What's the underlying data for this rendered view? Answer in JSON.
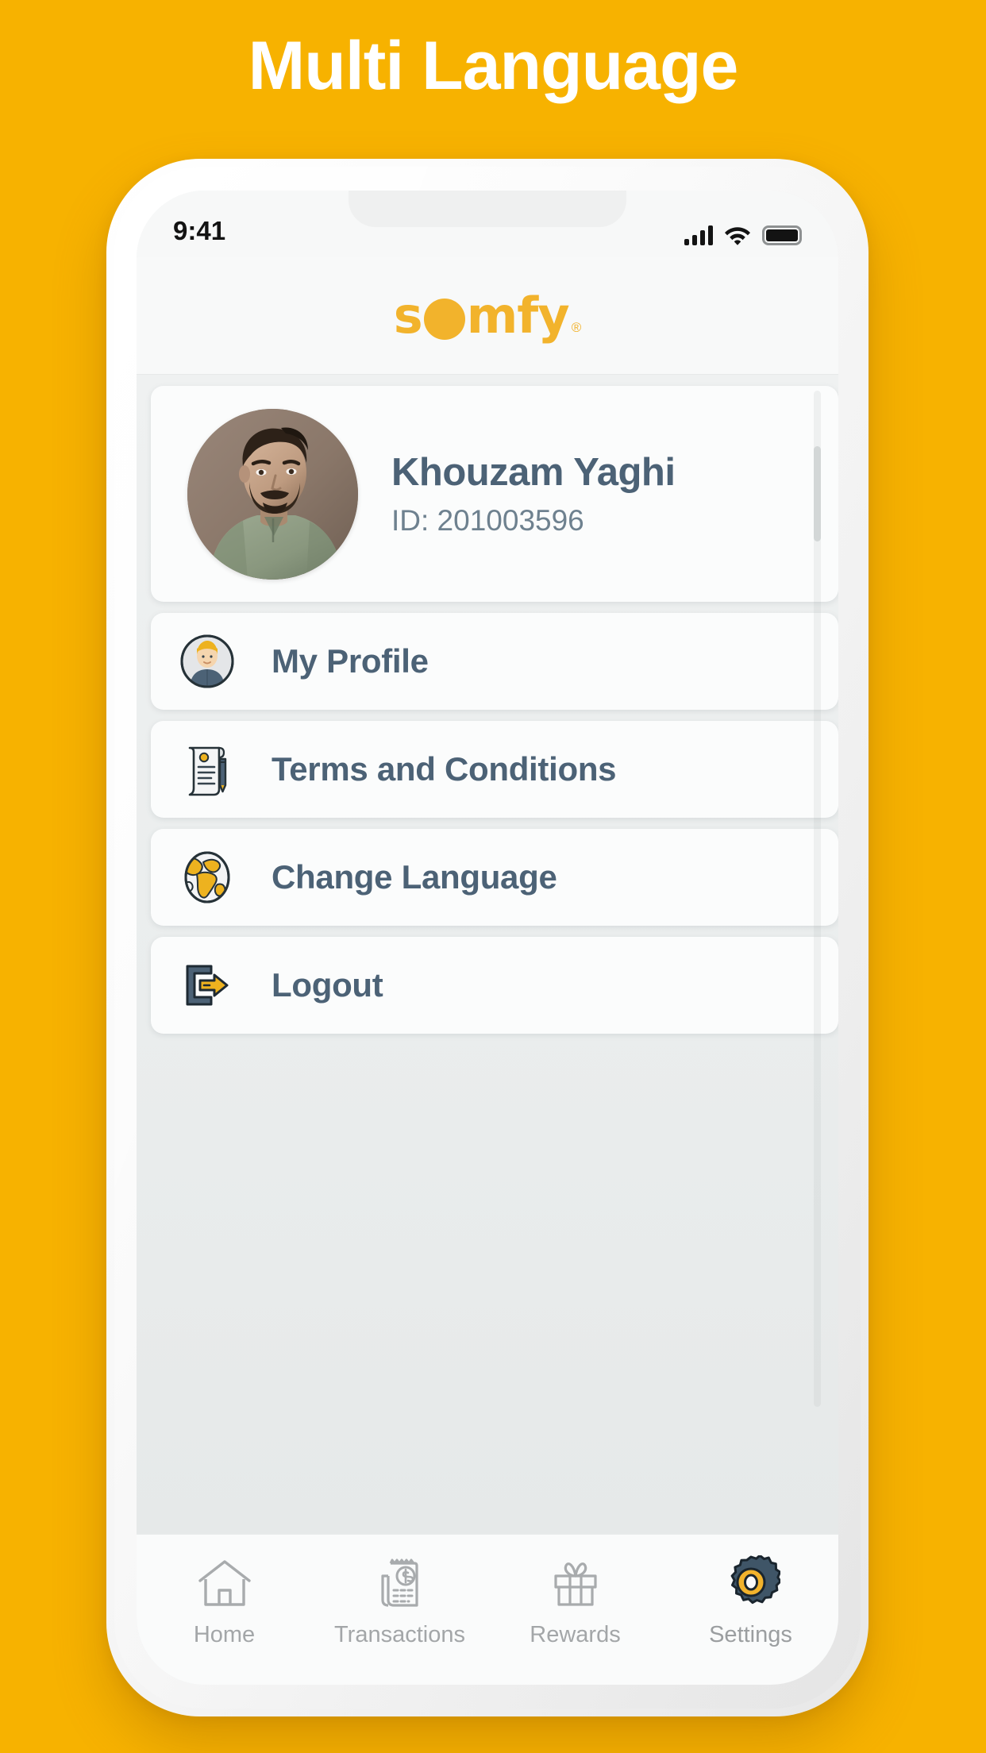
{
  "page": {
    "headline": "Multi Language",
    "background_color": "#F7B200",
    "accent_color": "#F2B32C",
    "text_color": "#4C6276"
  },
  "status_bar": {
    "time": "9:41",
    "signal_icon": "cellular-signal-icon",
    "wifi_icon": "wifi-icon",
    "battery_icon": "battery-full-icon"
  },
  "app_header": {
    "logo_part1": "s",
    "logo_part2": "mfy",
    "logo_trademark": "®",
    "logo_name": "somfy"
  },
  "profile": {
    "name": "Khouzam Yaghi",
    "id_label": "ID: 201003596",
    "avatar_alt": "user-photo"
  },
  "menu": {
    "items": [
      {
        "label": "My Profile",
        "icon": "user-avatar-icon"
      },
      {
        "label": "Terms and Conditions",
        "icon": "document-pen-icon"
      },
      {
        "label": "Change Language",
        "icon": "globe-icon"
      },
      {
        "label": "Logout",
        "icon": "logout-arrow-icon"
      }
    ]
  },
  "bottom_nav": {
    "items": [
      {
        "label": "Home",
        "icon": "home-icon",
        "active": false
      },
      {
        "label": "Transactions",
        "icon": "receipt-dollar-icon",
        "active": false
      },
      {
        "label": "Rewards",
        "icon": "gift-box-icon",
        "active": false
      },
      {
        "label": "Settings",
        "icon": "gear-icon",
        "active": true
      }
    ]
  }
}
